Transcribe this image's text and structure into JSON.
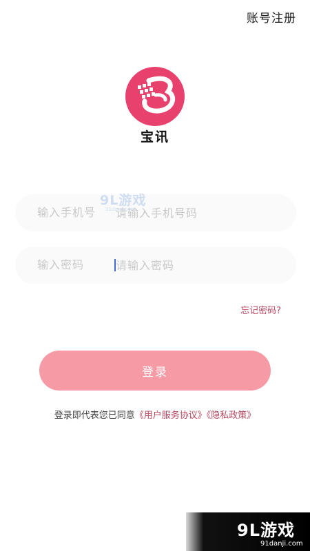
{
  "header": {
    "register_label": "账号注册"
  },
  "app": {
    "name": "宝讯",
    "logo_color": "#e8416d"
  },
  "form": {
    "phone": {
      "label": "输入手机号",
      "placeholder": "请输入手机号码",
      "value": ""
    },
    "password": {
      "label": "输入密码",
      "placeholder": "请输入密码",
      "value": ""
    },
    "forgot_label": "忘记密码?",
    "login_label": "登录"
  },
  "agreement": {
    "prefix": "登录即代表您已同意",
    "terms_label": "《用户服务协议》",
    "privacy_label": "《隐私政策》"
  },
  "watermark": {
    "brand": "9L游戏",
    "site": "91danji.com"
  },
  "colors": {
    "accent": "#b5485f",
    "button": "#f69aa6"
  }
}
